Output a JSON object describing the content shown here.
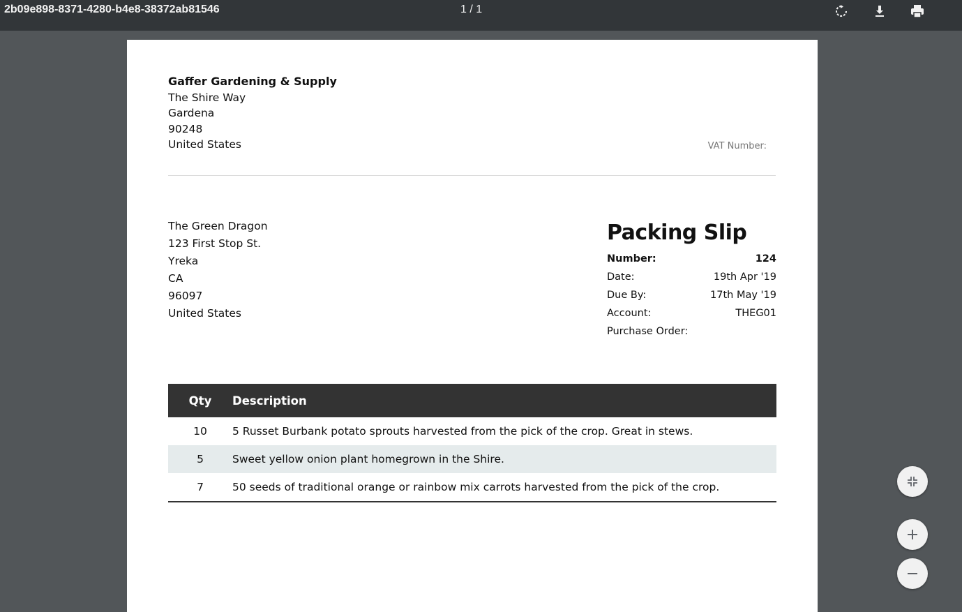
{
  "viewer": {
    "title": "2b09e898-8371-4280-b4e8-38372ab81546",
    "page_indicator": "1 / 1",
    "icons": [
      "rotate-icon",
      "download-icon",
      "print-icon",
      "fit-page-icon",
      "zoom-in-icon",
      "zoom-out-icon"
    ]
  },
  "seller": {
    "name": "Gaffer Gardening & Supply",
    "address": [
      "The Shire Way",
      "Gardena",
      "90248",
      "United States"
    ],
    "vat_label": "VAT Number:"
  },
  "buyer": {
    "lines": [
      "The Green Dragon",
      "123 First Stop St.",
      "Yreka",
      "CA",
      "96097",
      "United States"
    ]
  },
  "slip": {
    "title": "Packing Slip",
    "number_label": "Number:",
    "number": "124",
    "date_label": "Date:",
    "date": "19th Apr '19",
    "due_label": "Due By:",
    "due": "17th May '19",
    "account_label": "Account:",
    "account": "THEG01",
    "po_label": "Purchase Order:",
    "po": ""
  },
  "items": {
    "headers": {
      "qty": "Qty",
      "description": "Description"
    },
    "rows": [
      {
        "qty": "10",
        "description": "5 Russet Burbank potato sprouts harvested from the pick of the crop. Great in stews."
      },
      {
        "qty": "5",
        "description": "Sweet yellow onion plant homegrown in the Shire."
      },
      {
        "qty": "7",
        "description": "50 seeds of traditional orange or rainbow mix carrots harvested from the pick of the crop."
      }
    ]
  },
  "colors": {
    "toolbar": "#323639",
    "background": "#525659",
    "table_header": "#333333",
    "row_alt": "#e5ebec"
  }
}
